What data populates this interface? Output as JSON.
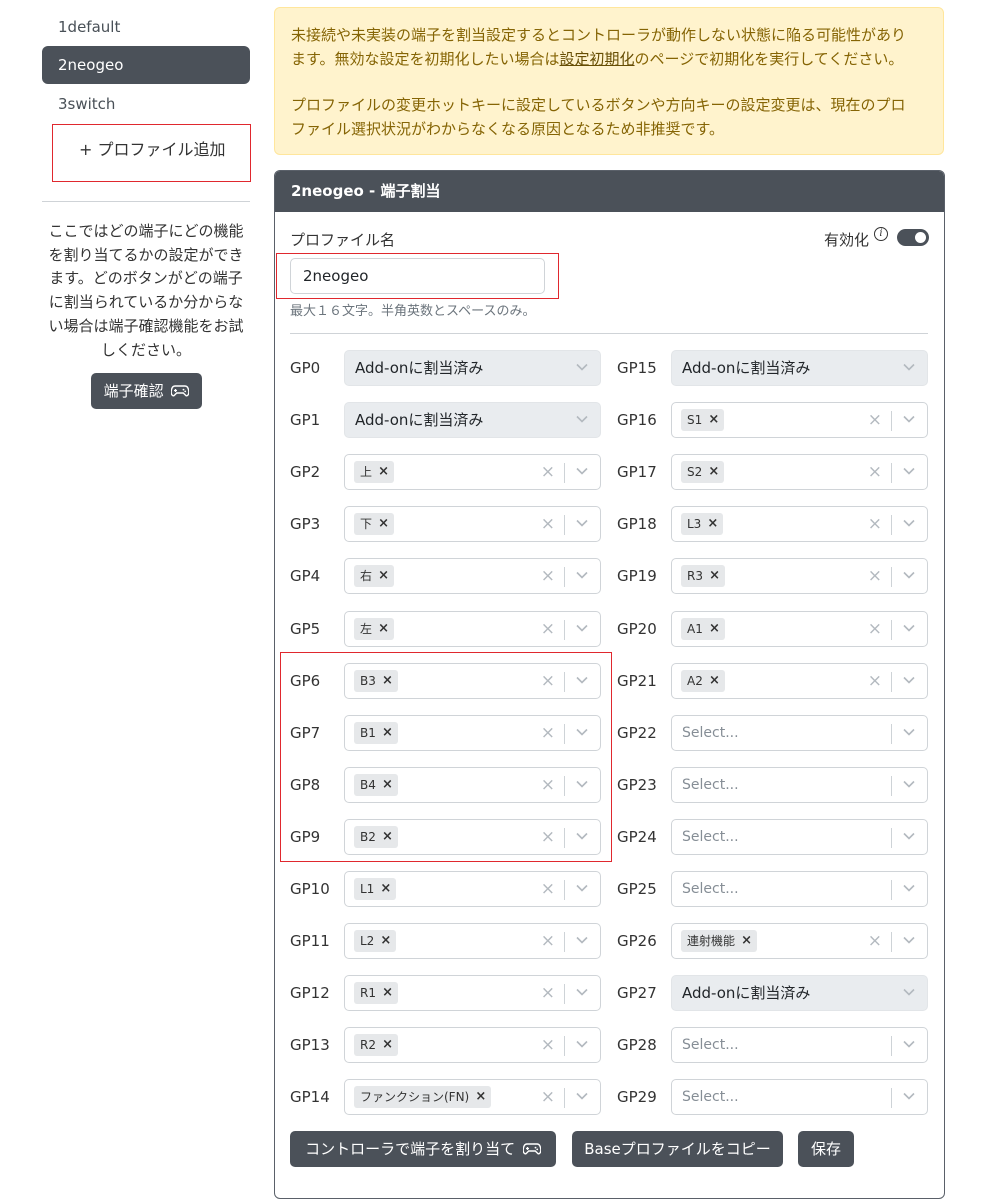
{
  "sidebar": {
    "profiles": [
      {
        "label": "1default",
        "active": false
      },
      {
        "label": "2neogeo",
        "active": true
      },
      {
        "label": "3switch",
        "active": false
      }
    ],
    "add_profile": "+ プロファイル追加",
    "help_lines": [
      "ここではどの端子にどの機能",
      "を割り当てるかの設定ができ",
      "ます。どのボタンがどの端子",
      "に割当られているか分からな",
      "い場合は端子確認機能をお試",
      "しください。"
    ],
    "pin_check_button": "端子確認"
  },
  "alert": {
    "p1_line1": "未接続や未実装の端子を割当設定するとコントローラが動作しない状態に陥る可能性があり",
    "p1_line2_pre": "ます。無効な設定を初期化したい場合は",
    "p1_link": "設定初期化",
    "p1_line2_post": "のページで初期化を実行してください。",
    "p2_line1": "プロファイルの変更ホットキーに設定しているボタンや方向キーの設定変更は、現在のプロ",
    "p2_line2": "ファイル選択状況がわからなくなる原因となるため非推奨です。"
  },
  "card": {
    "header": "2neogeo - 端子割当",
    "profile_name_label": "プロファイル名",
    "profile_name_value": "2neogeo",
    "enable_label": "有効化",
    "info_glyph": "i",
    "hint": "最大１６文字。半角英数とスペースのみ。"
  },
  "pins_left": [
    {
      "pin": "GP0",
      "kind": "disabled",
      "text": "Add-onに割当済み"
    },
    {
      "pin": "GP1",
      "kind": "disabled",
      "text": "Add-onに割当済み"
    },
    {
      "pin": "GP2",
      "kind": "chip",
      "text": "上"
    },
    {
      "pin": "GP3",
      "kind": "chip",
      "text": "下"
    },
    {
      "pin": "GP4",
      "kind": "chip",
      "text": "右"
    },
    {
      "pin": "GP5",
      "kind": "chip",
      "text": "左"
    },
    {
      "pin": "GP6",
      "kind": "chip",
      "text": "B3"
    },
    {
      "pin": "GP7",
      "kind": "chip",
      "text": "B1"
    },
    {
      "pin": "GP8",
      "kind": "chip",
      "text": "B4"
    },
    {
      "pin": "GP9",
      "kind": "chip",
      "text": "B2"
    },
    {
      "pin": "GP10",
      "kind": "chip",
      "text": "L1"
    },
    {
      "pin": "GP11",
      "kind": "chip",
      "text": "L2"
    },
    {
      "pin": "GP12",
      "kind": "chip",
      "text": "R1"
    },
    {
      "pin": "GP13",
      "kind": "chip",
      "text": "R2"
    },
    {
      "pin": "GP14",
      "kind": "chip",
      "text": "ファンクション(FN)"
    }
  ],
  "pins_right": [
    {
      "pin": "GP15",
      "kind": "disabled",
      "text": "Add-onに割当済み"
    },
    {
      "pin": "GP16",
      "kind": "chip",
      "text": "S1"
    },
    {
      "pin": "GP17",
      "kind": "chip",
      "text": "S2"
    },
    {
      "pin": "GP18",
      "kind": "chip",
      "text": "L3"
    },
    {
      "pin": "GP19",
      "kind": "chip",
      "text": "R3"
    },
    {
      "pin": "GP20",
      "kind": "chip",
      "text": "A1"
    },
    {
      "pin": "GP21",
      "kind": "chip",
      "text": "A2"
    },
    {
      "pin": "GP22",
      "kind": "empty",
      "text": "Select..."
    },
    {
      "pin": "GP23",
      "kind": "empty",
      "text": "Select..."
    },
    {
      "pin": "GP24",
      "kind": "empty",
      "text": "Select..."
    },
    {
      "pin": "GP25",
      "kind": "empty",
      "text": "Select..."
    },
    {
      "pin": "GP26",
      "kind": "chip",
      "text": "連射機能"
    },
    {
      "pin": "GP27",
      "kind": "disabled",
      "text": "Add-onに割当済み"
    },
    {
      "pin": "GP28",
      "kind": "empty",
      "text": "Select..."
    },
    {
      "pin": "GP29",
      "kind": "empty",
      "text": "Select..."
    }
  ],
  "chip_remove_glyph": "×",
  "clear_glyph": "×",
  "buttons": {
    "assign_by_controller": "コントローラで端子を割り当て",
    "copy_base": "Baseプロファイルをコピー",
    "save": "保存"
  },
  "colors": {
    "dark": "#4b5159",
    "alert_bg": "#fff3cd",
    "alert_text": "#856404",
    "highlight": "#e0282e"
  }
}
